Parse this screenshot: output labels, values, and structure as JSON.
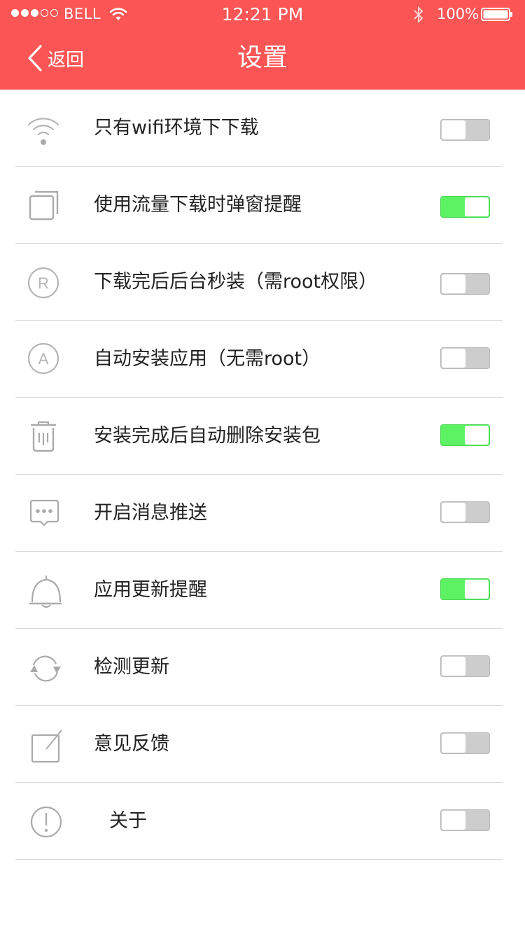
{
  "status_bar": {
    "carrier": "BELL",
    "time": "12:21 PM",
    "battery": "100%",
    "signal_bars_filled": 3,
    "signal_bars_total": 5
  },
  "header": {
    "back_label": "返回",
    "title": "设置"
  },
  "colors": {
    "header_bg": "#fb5655",
    "toggle_on": "#5df263",
    "toggle_off": "#cdcdcd"
  },
  "settings": [
    {
      "icon": "wifi-icon",
      "label": "只有wifi环境下下载",
      "enabled": false
    },
    {
      "icon": "copy-icon",
      "label": "使用流量下载时弹窗提醒",
      "enabled": true
    },
    {
      "icon": "root-icon",
      "label": "下载完后后台秒装（需root权限）",
      "enabled": false
    },
    {
      "icon": "auto-install-icon",
      "label": "自动安装应用（无需root）",
      "enabled": false
    },
    {
      "icon": "trash-icon",
      "label": "安装完成后自动删除安装包",
      "enabled": true
    },
    {
      "icon": "message-icon",
      "label": "开启消息推送",
      "enabled": false
    },
    {
      "icon": "bell-icon",
      "label": "应用更新提醒",
      "enabled": true
    },
    {
      "icon": "refresh-icon",
      "label": "检测更新",
      "enabled": false
    },
    {
      "icon": "feedback-icon",
      "label": "意见反馈",
      "enabled": false
    },
    {
      "icon": "info-icon",
      "label": "关于",
      "enabled": false
    }
  ]
}
